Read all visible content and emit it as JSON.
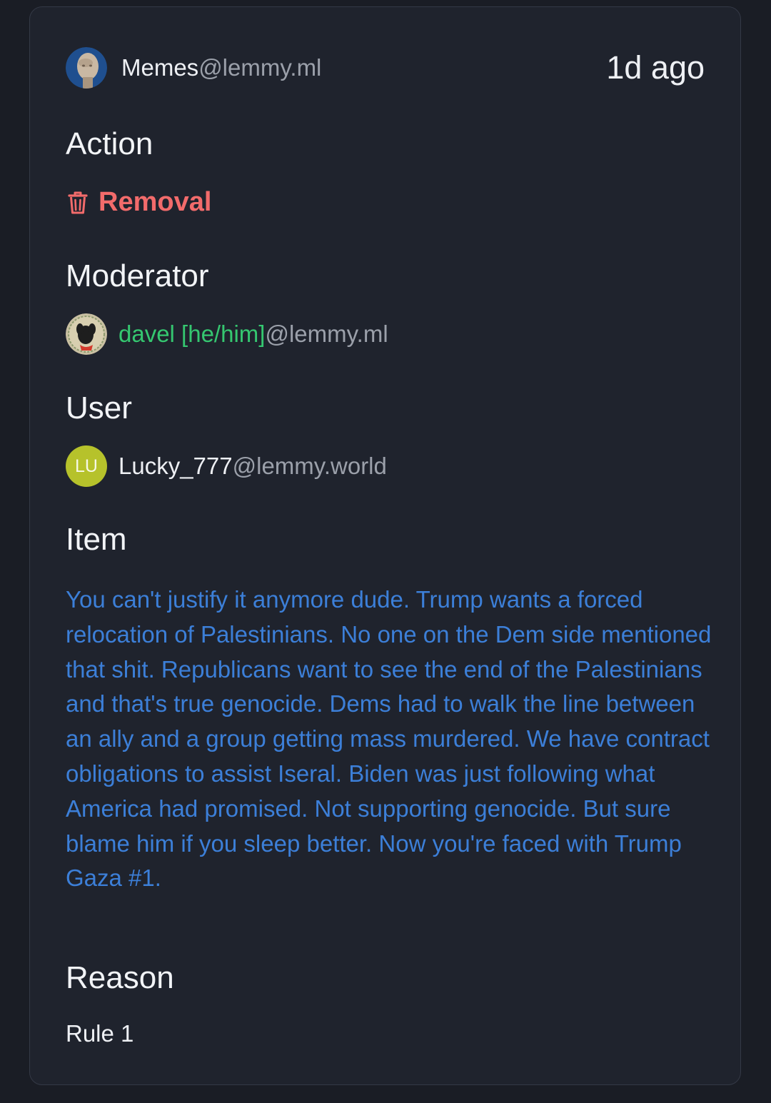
{
  "community": {
    "name": "Memes",
    "domain": "@lemmy.ml",
    "avatar_icon": "meme-man-avatar"
  },
  "timestamp": "1d ago",
  "action": {
    "heading": "Action",
    "label": "Removal",
    "icon": "trash-icon",
    "color": "#f26b6b"
  },
  "moderator": {
    "heading": "Moderator",
    "name": "davel [he/him]",
    "domain": "@lemmy.ml",
    "avatar_icon": "dog-avatar",
    "color": "#35c770"
  },
  "user": {
    "heading": "User",
    "initials": "LU",
    "name": "Lucky_777",
    "domain": "@lemmy.world",
    "avatar_color": "#b6c22b"
  },
  "item": {
    "heading": "Item",
    "text": "You can't justify it anymore dude. Trump wants a forced relocation of Palestinians. No one on the Dem side mentioned that shit. Republicans want to see the end of the Palestinians and that's true genocide. Dems had to walk the line between an ally and a group getting mass murdered. We have contract obligations to assist Iseral. Biden was just following what America had promised. Not supporting genocide. But sure blame him if you sleep better. Now you're faced with Trump Gaza #1.",
    "color": "#3c7fd8"
  },
  "reason": {
    "heading": "Reason",
    "text": "Rule 1"
  }
}
